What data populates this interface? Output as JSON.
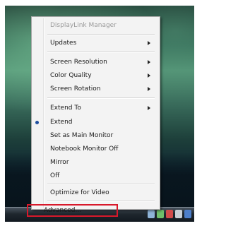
{
  "menu": {
    "title": "DisplayLink Manager",
    "items": {
      "updates": "Updates",
      "screen_resolution": "Screen Resolution",
      "color_quality": "Color Quality",
      "screen_rotation": "Screen Rotation",
      "extend_to": "Extend To",
      "extend": "Extend",
      "set_main": "Set as Main Monitor",
      "notebook_off": "Notebook Monitor Off",
      "mirror": "Mirror",
      "off": "Off",
      "optimize_video": "Optimize for Video",
      "advanced": "Advanced..."
    },
    "selected_item": "Extend"
  },
  "colors": {
    "highlight_border": "#d8192b",
    "bullet": "#1f4fa0"
  },
  "icons": [
    "submenu-arrow-icon",
    "radio-bullet-icon",
    "tray-icon"
  ]
}
